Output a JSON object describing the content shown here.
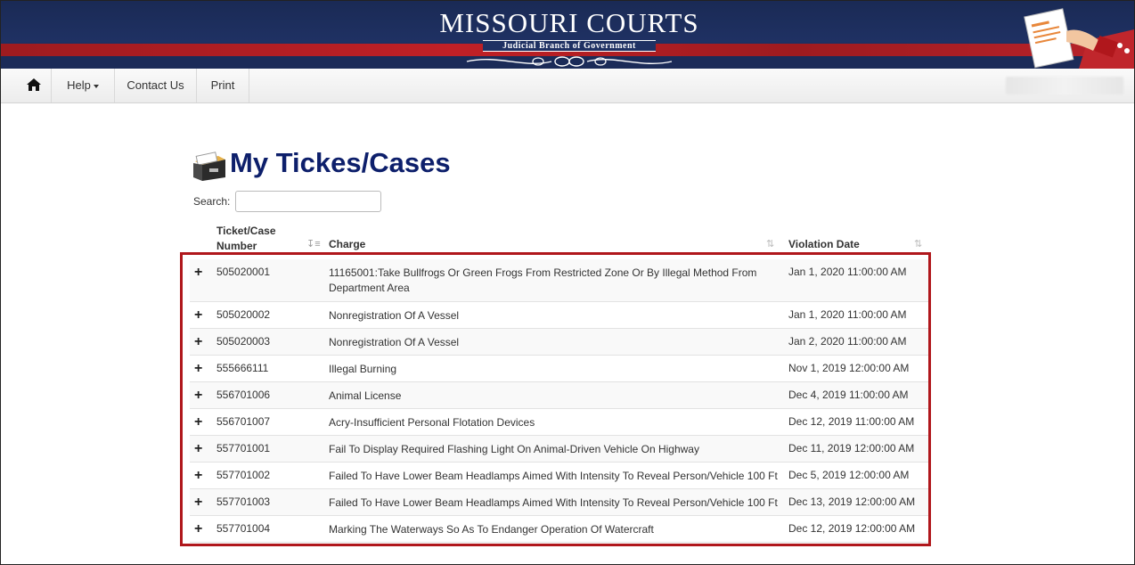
{
  "header": {
    "brand_title": "MISSOURI COURTS",
    "brand_subtitle": "Judicial Branch of Government"
  },
  "nav": {
    "home_icon": "home-icon",
    "help_label": "Help",
    "contact_label": "Contact Us",
    "print_label": "Print"
  },
  "page": {
    "title": "My Tickes/Cases",
    "title_icon": "file-cabinet-icon"
  },
  "search": {
    "label": "Search:",
    "value": ""
  },
  "table": {
    "columns": {
      "number_line1": "Ticket/Case",
      "number_line2": "Number",
      "charge": "Charge",
      "violation_date": "Violation Date"
    },
    "expand_glyph": "+",
    "rows": [
      {
        "number": "505020001",
        "charge": "11165001:Take Bullfrogs Or Green Frogs From Restricted Zone Or By Illegal Method From Department Area",
        "date": "Jan 1, 2020 11:00:00 AM"
      },
      {
        "number": "505020002",
        "charge": "Nonregistration Of A Vessel",
        "date": "Jan 1, 2020 11:00:00 AM"
      },
      {
        "number": "505020003",
        "charge": "Nonregistration Of A Vessel",
        "date": "Jan 2, 2020 11:00:00 AM"
      },
      {
        "number": "555666111",
        "charge": "Illegal Burning",
        "date": "Nov 1, 2019 12:00:00 AM"
      },
      {
        "number": "556701006",
        "charge": "Animal License",
        "date": "Dec 4, 2019 11:00:00 AM"
      },
      {
        "number": "556701007",
        "charge": "Acry-Insufficient Personal Flotation Devices",
        "date": "Dec 12, 2019 11:00:00 AM"
      },
      {
        "number": "557701001",
        "charge": "Fail To Display Required Flashing Light On Animal-Driven Vehicle On Highway",
        "date": "Dec 11, 2019 12:00:00 AM"
      },
      {
        "number": "557701002",
        "charge": "Failed To Have Lower Beam Headlamps Aimed With Intensity To Reveal Person/Vehicle 100 Ft",
        "date": "Dec 5, 2019 12:00:00 AM"
      },
      {
        "number": "557701003",
        "charge": "Failed To Have Lower Beam Headlamps Aimed With Intensity To Reveal Person/Vehicle 100 Ft",
        "date": "Dec 13, 2019 12:00:00 AM"
      },
      {
        "number": "557701004",
        "charge": "Marking The Waterways So As To Endanger Operation Of Watercraft",
        "date": "Dec 12, 2019 12:00:00 AM"
      }
    ]
  },
  "colors": {
    "banner_navy": "#1f3163",
    "banner_red": "#c02026",
    "title_navy": "#0d1f6b",
    "highlight_red": "#b0171c"
  }
}
